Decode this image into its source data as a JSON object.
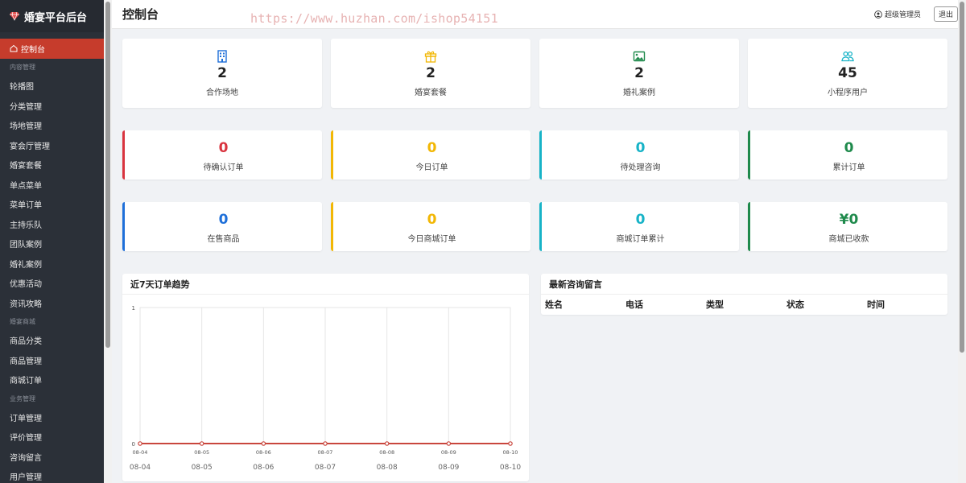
{
  "app": {
    "title": "婚宴平台后台"
  },
  "sidebar": {
    "items": [
      {
        "type": "item",
        "label": "控制台",
        "active": true,
        "key": "dashboard"
      },
      {
        "type": "group",
        "label": "内容管理"
      },
      {
        "type": "item",
        "label": "轮播图",
        "key": "banner"
      },
      {
        "type": "item",
        "label": "分类管理",
        "key": "category"
      },
      {
        "type": "item",
        "label": "场地管理",
        "key": "venue"
      },
      {
        "type": "item",
        "label": "宴会厅管理",
        "key": "hall"
      },
      {
        "type": "item",
        "label": "婚宴套餐",
        "key": "package"
      },
      {
        "type": "item",
        "label": "单点菜单",
        "key": "alacarte"
      },
      {
        "type": "item",
        "label": "菜单订单",
        "key": "menu-order"
      },
      {
        "type": "item",
        "label": "主持乐队",
        "key": "band"
      },
      {
        "type": "item",
        "label": "团队案例",
        "key": "team-case"
      },
      {
        "type": "item",
        "label": "婚礼案例",
        "key": "wedding-case"
      },
      {
        "type": "item",
        "label": "优惠活动",
        "key": "promotion"
      },
      {
        "type": "item",
        "label": "资讯攻略",
        "key": "news"
      },
      {
        "type": "group",
        "label": "婚宴商城"
      },
      {
        "type": "item",
        "label": "商品分类",
        "key": "goods-category"
      },
      {
        "type": "item",
        "label": "商品管理",
        "key": "goods"
      },
      {
        "type": "item",
        "label": "商城订单",
        "key": "shop-order"
      },
      {
        "type": "group",
        "label": "业务管理"
      },
      {
        "type": "item",
        "label": "订单管理",
        "key": "orders"
      },
      {
        "type": "item",
        "label": "评价管理",
        "key": "reviews"
      },
      {
        "type": "item",
        "label": "咨询留言",
        "key": "messages"
      },
      {
        "type": "item",
        "label": "用户管理",
        "key": "users"
      }
    ]
  },
  "header": {
    "title": "控制台",
    "watermark": "https://www.huzhan.com/ishop54151",
    "user": "超级管理员",
    "logout": "退出"
  },
  "stats": [
    {
      "value": "2",
      "label": "合作场地",
      "icon": "building-icon",
      "color": "#1e6fd9"
    },
    {
      "value": "2",
      "label": "婚宴套餐",
      "icon": "gift-icon",
      "color": "#f2b705"
    },
    {
      "value": "2",
      "label": "婚礼案例",
      "icon": "image-icon",
      "color": "#1f8a4c"
    },
    {
      "value": "45",
      "label": "小程序用户",
      "icon": "users-icon",
      "color": "#17b3c7"
    }
  ],
  "order_stats": [
    {
      "value": "0",
      "label": "待确认订单",
      "color": "#d9343f"
    },
    {
      "value": "0",
      "label": "今日订单",
      "color": "#f2b705"
    },
    {
      "value": "0",
      "label": "待处理咨询",
      "color": "#17b3c7"
    },
    {
      "value": "0",
      "label": "累计订单",
      "color": "#1f8a4c"
    }
  ],
  "shop_stats": [
    {
      "value": "0",
      "label": "在售商品",
      "color": "#1e6fd9"
    },
    {
      "value": "0",
      "label": "今日商城订单",
      "color": "#f2b705"
    },
    {
      "value": "0",
      "label": "商城订单累计",
      "color": "#17b3c7"
    },
    {
      "value": "¥0",
      "label": "商城已收款",
      "color": "#1f8a4c"
    }
  ],
  "trend": {
    "title": "近7天订单趋势"
  },
  "messages": {
    "title": "最新咨询留言",
    "columns": [
      "姓名",
      "电话",
      "类型",
      "状态",
      "时间"
    ]
  },
  "chart_data": {
    "type": "line",
    "title": "",
    "x": [
      "08-04",
      "08-05",
      "08-06",
      "08-07",
      "08-08",
      "08-09",
      "08-10"
    ],
    "series": [
      {
        "values": [
          0,
          0,
          0,
          0,
          0,
          0,
          0
        ],
        "color": "#c9463d"
      }
    ],
    "ylim": [
      0,
      1
    ],
    "yticks": [
      0,
      1
    ],
    "grid": true,
    "xlabel": "",
    "ylabel": ""
  }
}
